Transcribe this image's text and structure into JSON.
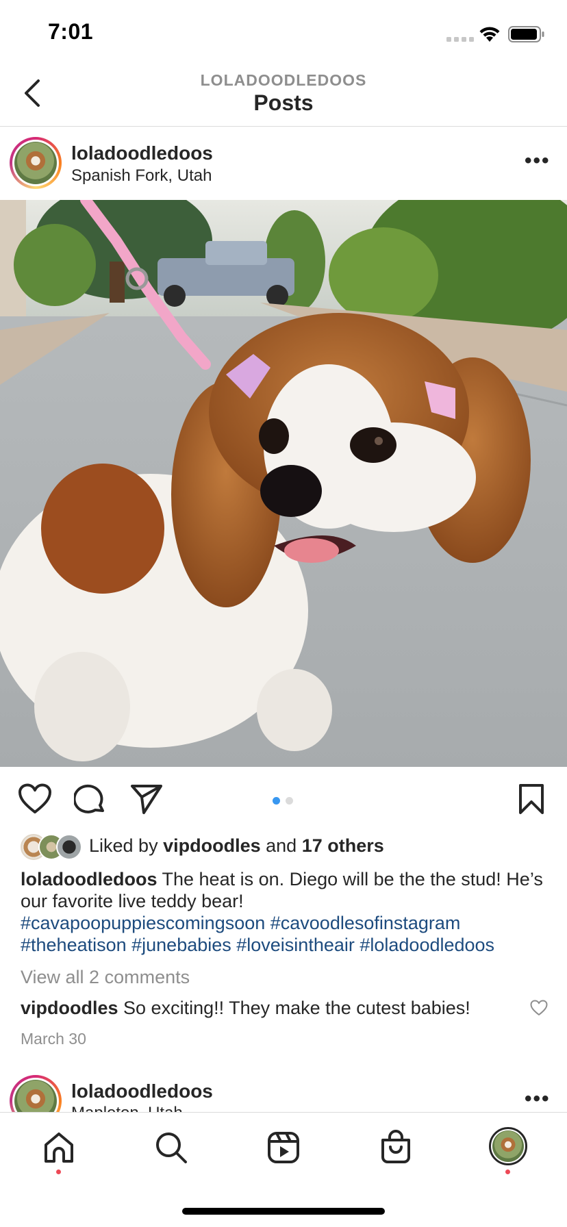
{
  "status_bar": {
    "time": "7:01"
  },
  "header": {
    "subtitle": "LOLADOODLEDOOS",
    "title": "Posts"
  },
  "post": {
    "username": "loladoodledoos",
    "location": "Spanish Fork, Utah",
    "more_label": "•••",
    "carousel": {
      "count": 2,
      "active_index": 0,
      "active_color": "#3897f0",
      "inactive_color": "#dbdbdb"
    },
    "likes": {
      "prefix": "Liked by",
      "user": "vipdoodles",
      "middle": "and",
      "others": "17 others"
    },
    "caption": {
      "username": "loladoodledoos",
      "text": "The heat is on. Diego will be the the stud! He’s our favorite live teddy bear!",
      "hashtags_line1": "#cavapoopuppiescomingsoon #cavoodlesofinstagram",
      "hashtags_line2": "#theheatison #junebabies #loveisintheair #loladoodledoos"
    },
    "view_comments": "View all 2 comments",
    "comment": {
      "username": "vipdoodles",
      "text": "So exciting!! They make the cutest babies!"
    },
    "date": "March 30"
  },
  "next_post": {
    "username": "loladoodledoos",
    "location": "Mapleton, Utah",
    "more_label": "•••"
  },
  "nav": {
    "items": [
      "home-icon",
      "search-icon",
      "reels-icon",
      "shop-icon",
      "profile-avatar"
    ],
    "notification_color": "#ed4956"
  },
  "colors": {
    "hashtag": "#1d4b7e",
    "secondary_text": "#8e8e8e",
    "divider": "#dbdbdb"
  }
}
